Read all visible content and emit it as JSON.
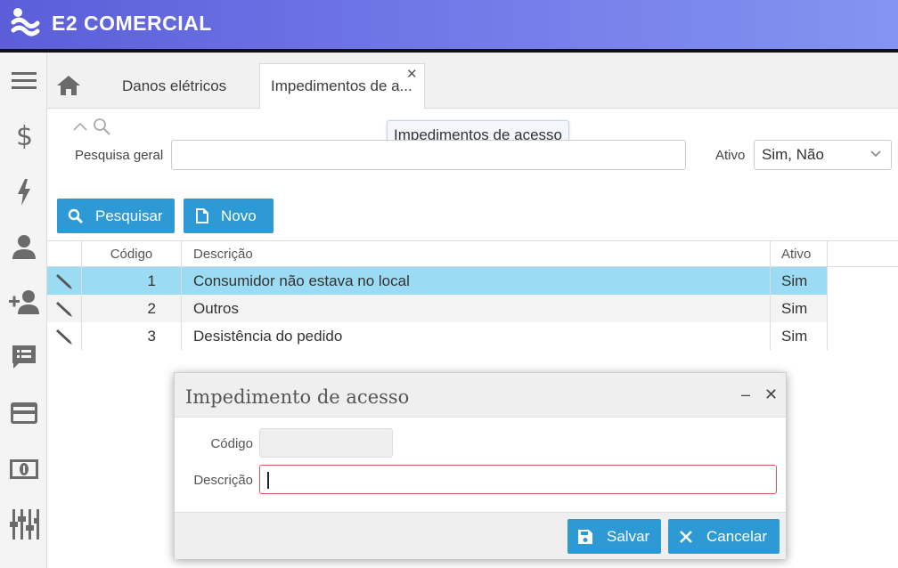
{
  "app": {
    "title": "E2 COMERCIAL"
  },
  "sidebar": {
    "items": [
      {
        "icon": "menu-icon"
      },
      {
        "icon": "dollar-icon"
      },
      {
        "icon": "lightning-icon"
      },
      {
        "icon": "user-icon"
      },
      {
        "icon": "add-user-icon"
      },
      {
        "icon": "chat-icon"
      },
      {
        "icon": "credit-card-icon"
      },
      {
        "icon": "money-icon"
      },
      {
        "icon": "sliders-icon"
      }
    ]
  },
  "tabs": {
    "home_icon": "home-icon",
    "items": [
      {
        "label": "Danos elétricos"
      },
      {
        "label": "Impedimentos de a..."
      }
    ],
    "tooltip": "Impedimentos de acesso"
  },
  "search": {
    "label": "Pesquisa geral",
    "value": "",
    "ativo_label": "Ativo",
    "ativo_value": "Sim, Não",
    "pesquisar_label": "Pesquisar",
    "novo_label": "Novo"
  },
  "grid": {
    "headers": {
      "codigo": "Código",
      "descricao": "Descrição",
      "ativo": "Ativo"
    },
    "rows": [
      {
        "codigo": "1",
        "descricao": "Consumidor não estava no local",
        "ativo": "Sim"
      },
      {
        "codigo": "2",
        "descricao": "Outros",
        "ativo": "Sim"
      },
      {
        "codigo": "3",
        "descricao": "Desistência do pedido",
        "ativo": "Sim"
      }
    ]
  },
  "modal": {
    "title": "Impedimento de acesso",
    "minimize": "–",
    "close": "✕",
    "codigo_label": "Código",
    "codigo_value": "",
    "descricao_label": "Descrição",
    "descricao_value": "",
    "salvar_label": "Salvar",
    "cancelar_label": "Cancelar"
  },
  "colors": {
    "primary": "#2d9ad6",
    "selected_row": "#9bdbf3",
    "error_border": "#d9534f",
    "topbar_start": "#5b5ed8",
    "topbar_end": "#8494f0"
  }
}
